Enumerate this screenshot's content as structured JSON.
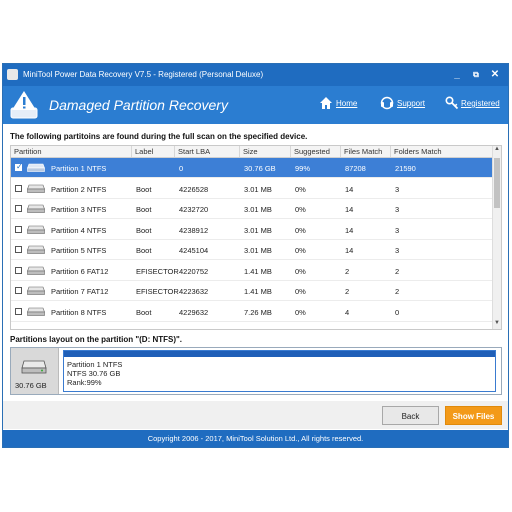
{
  "window": {
    "title": "MiniTool Power Data Recovery V7.5 - Registered (Personal Deluxe)",
    "controls": {
      "minimize": "_",
      "restore": "⧉",
      "close": "✕"
    }
  },
  "header": {
    "title": "Damaged Partition Recovery",
    "links": [
      {
        "label": "Home",
        "icon": "home-icon"
      },
      {
        "label": "Support",
        "icon": "support-icon"
      },
      {
        "label": "Registered",
        "icon": "key-icon"
      }
    ]
  },
  "found_text": "The following partitoins are found during the full scan on the specified device.",
  "table": {
    "columns": [
      "Partition",
      "Label",
      "Start LBA",
      "Size",
      "Suggested",
      "Files Match",
      "Folders Match"
    ],
    "rows": [
      {
        "checked": true,
        "selected": true,
        "partition": "Partition 1 NTFS",
        "label": "",
        "start_lba": "0",
        "size": "30.76 GB",
        "suggested": "99%",
        "files": "87208",
        "folders": "21590"
      },
      {
        "checked": false,
        "selected": false,
        "partition": "Partition 2 NTFS",
        "label": "Boot",
        "start_lba": "4226528",
        "size": "3.01 MB",
        "suggested": "0%",
        "files": "14",
        "folders": "3"
      },
      {
        "checked": false,
        "selected": false,
        "partition": "Partition 3 NTFS",
        "label": "Boot",
        "start_lba": "4232720",
        "size": "3.01 MB",
        "suggested": "0%",
        "files": "14",
        "folders": "3"
      },
      {
        "checked": false,
        "selected": false,
        "partition": "Partition 4 NTFS",
        "label": "Boot",
        "start_lba": "4238912",
        "size": "3.01 MB",
        "suggested": "0%",
        "files": "14",
        "folders": "3"
      },
      {
        "checked": false,
        "selected": false,
        "partition": "Partition 5 NTFS",
        "label": "Boot",
        "start_lba": "4245104",
        "size": "3.01 MB",
        "suggested": "0%",
        "files": "14",
        "folders": "3"
      },
      {
        "checked": false,
        "selected": false,
        "partition": "Partition 6 FAT12",
        "label": "EFISECTOR",
        "start_lba": "4220752",
        "size": "1.41 MB",
        "suggested": "0%",
        "files": "2",
        "folders": "2"
      },
      {
        "checked": false,
        "selected": false,
        "partition": "Partition 7 FAT12",
        "label": "EFISECTOR",
        "start_lba": "4223632",
        "size": "1.41 MB",
        "suggested": "0%",
        "files": "2",
        "folders": "2"
      },
      {
        "checked": false,
        "selected": false,
        "partition": "Partition 8 NTFS",
        "label": "Boot",
        "start_lba": "4229632",
        "size": "7.26 MB",
        "suggested": "0%",
        "files": "4",
        "folders": "0"
      }
    ]
  },
  "layout": {
    "heading": "Partitions layout on the partition \"(D: NTFS)\".",
    "disk_size": "30.76 GB",
    "lines": [
      "Partition 1 NTFS",
      "NTFS 30.76 GB",
      "Rank:99%"
    ]
  },
  "buttons": {
    "back": "Back",
    "show_files": "Show Files"
  },
  "footer": "Copyright 2006 - 2017, MiniTool Solution Ltd., All rights reserved.",
  "colors": {
    "title_bar": "#1f6cc0",
    "header": "#2b7dd1",
    "selected_row": "#3d7fd6",
    "show_files": "#f39a19"
  }
}
